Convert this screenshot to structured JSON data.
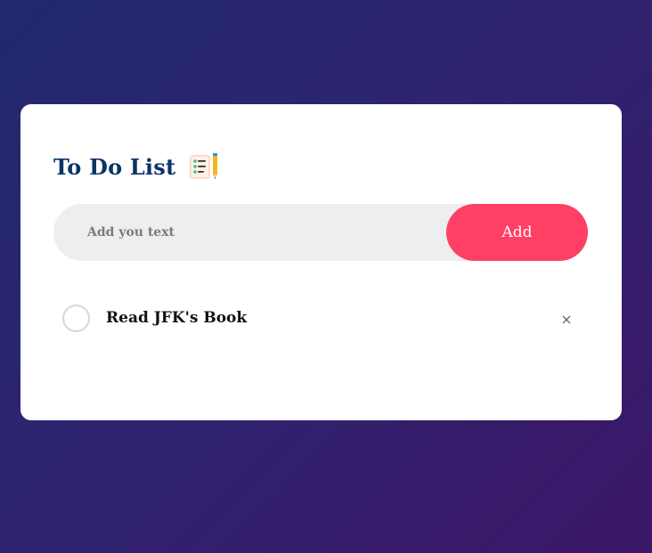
{
  "header": {
    "title": "To Do List",
    "title_icon": "checklist-notepad-pencil-icon"
  },
  "input": {
    "placeholder": "Add you text",
    "value": ""
  },
  "add_button": {
    "label": "Add",
    "color": "#ff3f63"
  },
  "tasks": [
    {
      "label": "Read JFK's Book",
      "checked": false,
      "delete_icon": "close-icon"
    }
  ],
  "colors": {
    "title": "#0b3468",
    "background_start": "#22296e",
    "background_end": "#3d1768",
    "card": "#ffffff",
    "input_bg": "#edeef0"
  }
}
